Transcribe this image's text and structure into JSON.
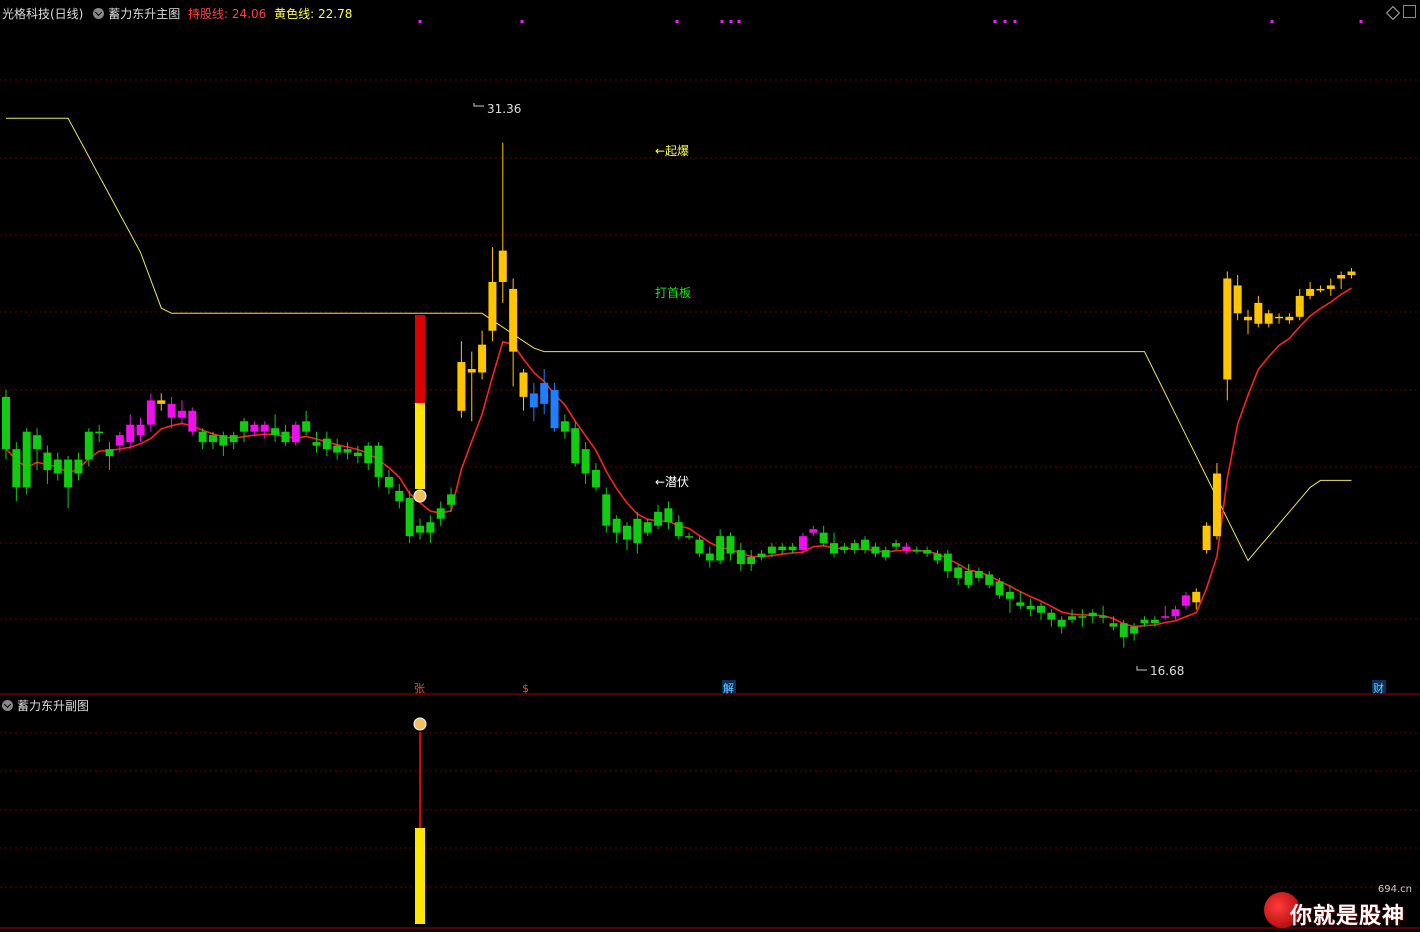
{
  "header": {
    "stock_name": "光格科技(日线)",
    "main_title": "蓄力东升主图",
    "hold_label": "持股线:",
    "hold_value": "24.06",
    "yellow_label": "黄色线:",
    "yellow_value": "22.78",
    "sub_title": "蓄力东升副图"
  },
  "colors": {
    "up_green": "#11cc11",
    "magenta": "#ee11ee",
    "orange": "#ffc600",
    "blue": "#1e7fff",
    "red_ma": "#ff2020",
    "yellow_line": "#e6e65a",
    "grid": "#6a0000",
    "hold_text": "#ff4040",
    "yellow_text": "#ffff40"
  },
  "annotations": {
    "high_label": "31.36",
    "low_label": "16.68",
    "qibao": "←起爆",
    "dashouban": "打首板",
    "qianfu": "←潜伏"
  },
  "markers": {
    "zhang": "张",
    "dollar": "$",
    "jie": "解",
    "cai": "财"
  },
  "watermark": {
    "text": "你就是股神",
    "site": "694.cn"
  },
  "chart_data": {
    "type": "candlestick",
    "ylim": [
      16.2,
      33.0
    ],
    "candles": [
      [
        23.9,
        22.4,
        24.1,
        22.1,
        "g"
      ],
      [
        22.4,
        21.3,
        22.6,
        20.9,
        "g"
      ],
      [
        22.9,
        21.3,
        23.0,
        21.1,
        "g"
      ],
      [
        22.8,
        22.4,
        23.0,
        21.8,
        "g"
      ],
      [
        22.3,
        21.8,
        22.5,
        21.4,
        "g"
      ],
      [
        22.1,
        21.7,
        22.3,
        21.5,
        "g"
      ],
      [
        22.1,
        21.3,
        22.2,
        20.7,
        "g"
      ],
      [
        21.7,
        22.1,
        22.3,
        21.5,
        "g"
      ],
      [
        22.1,
        22.9,
        23.0,
        21.9,
        "g"
      ],
      [
        22.9,
        22.9,
        23.1,
        22.6,
        "g"
      ],
      [
        22.2,
        22.4,
        22.6,
        21.8,
        "g"
      ],
      [
        22.8,
        22.5,
        22.9,
        22.3,
        "m"
      ],
      [
        23.1,
        22.6,
        23.4,
        22.4,
        "m"
      ],
      [
        23.1,
        22.8,
        23.3,
        22.6,
        "m"
      ],
      [
        23.8,
        23.1,
        24.0,
        22.9,
        "m"
      ],
      [
        23.8,
        23.7,
        24.0,
        23.5,
        "o"
      ],
      [
        23.7,
        23.3,
        23.9,
        23.0,
        "m"
      ],
      [
        23.5,
        23.3,
        23.8,
        23.1,
        "m"
      ],
      [
        23.5,
        22.9,
        23.6,
        22.8,
        "m"
      ],
      [
        22.9,
        22.6,
        23.0,
        22.4,
        "g"
      ],
      [
        22.8,
        22.6,
        22.9,
        22.4,
        "g"
      ],
      [
        22.8,
        22.5,
        22.9,
        22.2,
        "g"
      ],
      [
        22.8,
        22.6,
        22.9,
        22.4,
        "g"
      ],
      [
        23.2,
        22.9,
        23.3,
        22.6,
        "g"
      ],
      [
        23.1,
        22.9,
        23.2,
        22.8,
        "m"
      ],
      [
        23.1,
        22.9,
        23.2,
        22.7,
        "m"
      ],
      [
        23.0,
        22.8,
        23.4,
        22.6,
        "g"
      ],
      [
        22.9,
        22.6,
        23.1,
        22.5,
        "g"
      ],
      [
        23.1,
        22.6,
        23.2,
        22.5,
        "m"
      ],
      [
        23.2,
        22.9,
        23.5,
        22.8,
        "g"
      ],
      [
        22.6,
        22.5,
        22.9,
        22.3,
        "g"
      ],
      [
        22.7,
        22.4,
        22.9,
        22.2,
        "g"
      ],
      [
        22.5,
        22.3,
        22.7,
        22.1,
        "g"
      ],
      [
        22.4,
        22.3,
        22.6,
        22.1,
        "g"
      ],
      [
        22.3,
        22.2,
        22.5,
        22.0,
        "g"
      ],
      [
        22.5,
        22.0,
        22.6,
        21.8,
        "g"
      ],
      [
        22.5,
        21.6,
        22.6,
        21.3,
        "g"
      ],
      [
        21.6,
        21.3,
        21.8,
        21.1,
        "g"
      ],
      [
        21.2,
        20.9,
        21.4,
        20.7,
        "g"
      ],
      [
        21.0,
        19.9,
        21.2,
        19.7,
        "g"
      ],
      [
        20.0,
        20.2,
        20.4,
        19.8,
        "g"
      ],
      [
        20.3,
        20.0,
        20.5,
        19.7,
        "g"
      ],
      [
        20.7,
        20.4,
        20.9,
        20.2,
        "g"
      ],
      [
        21.1,
        20.8,
        21.3,
        20.6,
        "g"
      ],
      [
        23.5,
        24.9,
        25.5,
        23.3,
        "o"
      ],
      [
        24.6,
        24.7,
        25.2,
        23.2,
        "o"
      ],
      [
        24.6,
        25.4,
        25.8,
        24.4,
        "o"
      ],
      [
        25.8,
        27.2,
        28.2,
        25.5,
        "o"
      ],
      [
        27.2,
        28.1,
        31.2,
        26.6,
        "o"
      ],
      [
        27.0,
        25.2,
        27.3,
        24.2,
        "o"
      ],
      [
        24.6,
        23.9,
        24.7,
        23.5,
        "o"
      ],
      [
        24.0,
        23.6,
        24.3,
        23.2,
        "b"
      ],
      [
        24.3,
        23.7,
        24.7,
        23.4,
        "b"
      ],
      [
        24.1,
        23.0,
        24.3,
        22.9,
        "b"
      ],
      [
        23.2,
        22.9,
        23.4,
        22.7,
        "g"
      ],
      [
        23.0,
        22.0,
        23.2,
        21.9,
        "g"
      ],
      [
        22.4,
        21.7,
        22.6,
        21.4,
        "g"
      ],
      [
        21.8,
        21.3,
        22.0,
        21.2,
        "g"
      ],
      [
        21.1,
        20.2,
        21.3,
        20.0,
        "g"
      ],
      [
        20.4,
        20.0,
        20.5,
        19.7,
        "g"
      ],
      [
        20.2,
        19.8,
        20.3,
        19.5,
        "g"
      ],
      [
        20.4,
        19.7,
        20.6,
        19.4,
        "g"
      ],
      [
        20.3,
        20.0,
        20.4,
        19.9,
        "g"
      ],
      [
        20.6,
        20.2,
        20.8,
        20.1,
        "g"
      ],
      [
        20.7,
        20.3,
        20.9,
        20.1,
        "g"
      ],
      [
        20.3,
        19.9,
        20.5,
        19.8,
        "g"
      ],
      [
        19.9,
        19.9,
        20.0,
        19.8,
        "g"
      ],
      [
        19.8,
        19.4,
        19.9,
        19.3,
        "g"
      ],
      [
        19.4,
        19.2,
        19.6,
        19.0,
        "g"
      ],
      [
        19.9,
        19.2,
        20.1,
        19.1,
        "g"
      ],
      [
        19.9,
        19.4,
        20.0,
        19.2,
        "g"
      ],
      [
        19.5,
        19.1,
        19.7,
        18.9,
        "g"
      ],
      [
        19.3,
        19.1,
        19.5,
        18.9,
        "g"
      ],
      [
        19.4,
        19.3,
        19.5,
        19.2,
        "g"
      ],
      [
        19.6,
        19.4,
        19.7,
        19.3,
        "g"
      ],
      [
        19.6,
        19.5,
        19.7,
        19.4,
        "g"
      ],
      [
        19.6,
        19.5,
        19.7,
        19.4,
        "g"
      ],
      [
        19.9,
        19.5,
        20.0,
        19.4,
        "m"
      ],
      [
        20.1,
        20.0,
        20.2,
        19.9,
        "m"
      ],
      [
        20.0,
        19.7,
        20.2,
        19.6,
        "g"
      ],
      [
        19.7,
        19.4,
        20.0,
        19.3,
        "g"
      ],
      [
        19.6,
        19.5,
        19.7,
        19.4,
        "g"
      ],
      [
        19.7,
        19.5,
        19.8,
        19.4,
        "g"
      ],
      [
        19.8,
        19.5,
        19.9,
        19.4,
        "g"
      ],
      [
        19.6,
        19.4,
        19.7,
        19.3,
        "g"
      ],
      [
        19.5,
        19.3,
        19.6,
        19.2,
        "g"
      ],
      [
        19.7,
        19.6,
        19.8,
        19.5,
        "g"
      ],
      [
        19.6,
        19.5,
        19.7,
        19.4,
        "m"
      ],
      [
        19.5,
        19.5,
        19.6,
        19.4,
        "g"
      ],
      [
        19.5,
        19.4,
        19.6,
        19.3,
        "g"
      ],
      [
        19.4,
        19.2,
        19.5,
        19.1,
        "g"
      ],
      [
        19.4,
        18.9,
        19.5,
        18.7,
        "g"
      ],
      [
        19.0,
        18.7,
        19.1,
        18.5,
        "g"
      ],
      [
        18.9,
        18.5,
        19.1,
        18.4,
        "g"
      ],
      [
        18.9,
        18.7,
        19.0,
        18.6,
        "g"
      ],
      [
        18.8,
        18.5,
        18.9,
        18.4,
        "g"
      ],
      [
        18.6,
        18.2,
        18.7,
        18.1,
        "g"
      ],
      [
        18.3,
        18.1,
        18.5,
        17.7,
        "g"
      ],
      [
        18.0,
        17.9,
        18.3,
        17.8,
        "g"
      ],
      [
        17.9,
        17.8,
        18.1,
        17.6,
        "g"
      ],
      [
        17.9,
        17.7,
        18.0,
        17.5,
        "g"
      ],
      [
        17.7,
        17.5,
        17.8,
        17.3,
        "g"
      ],
      [
        17.5,
        17.3,
        17.6,
        17.1,
        "g"
      ],
      [
        17.6,
        17.5,
        17.8,
        17.4,
        "g"
      ],
      [
        17.6,
        17.6,
        17.8,
        17.3,
        "g"
      ],
      [
        17.7,
        17.6,
        17.8,
        17.4,
        "g"
      ],
      [
        17.6,
        17.6,
        17.9,
        17.4,
        "g"
      ],
      [
        17.4,
        17.3,
        17.6,
        17.2,
        "g"
      ],
      [
        17.4,
        17.0,
        17.5,
        16.7,
        "g"
      ],
      [
        17.3,
        17.1,
        17.4,
        16.9,
        "g"
      ],
      [
        17.5,
        17.4,
        17.6,
        17.3,
        "g"
      ],
      [
        17.5,
        17.4,
        17.6,
        17.3,
        "g"
      ],
      [
        17.6,
        17.6,
        17.9,
        17.5,
        "m"
      ],
      [
        17.8,
        17.6,
        17.9,
        17.5,
        "m"
      ],
      [
        18.2,
        17.9,
        18.3,
        17.8,
        "m"
      ],
      [
        18.3,
        18.0,
        18.4,
        17.8,
        "o"
      ],
      [
        19.5,
        20.2,
        20.3,
        19.4,
        "o"
      ],
      [
        19.9,
        21.7,
        22.0,
        19.8,
        "o"
      ],
      [
        24.4,
        27.3,
        27.5,
        23.8,
        "o"
      ],
      [
        26.3,
        27.1,
        27.4,
        26.1,
        "o"
      ],
      [
        26.2,
        26.1,
        26.4,
        25.7,
        "o"
      ],
      [
        26.0,
        26.6,
        26.8,
        25.9,
        "o"
      ],
      [
        26.3,
        26.0,
        26.4,
        25.9,
        "o"
      ],
      [
        26.2,
        26.2,
        26.3,
        26.0,
        "o"
      ],
      [
        26.2,
        26.1,
        26.3,
        26.0,
        "o"
      ],
      [
        26.2,
        26.8,
        27.0,
        26.1,
        "o"
      ],
      [
        26.8,
        27.0,
        27.2,
        26.7,
        "o"
      ],
      [
        27.0,
        27.0,
        27.1,
        26.9,
        "o"
      ],
      [
        27.0,
        27.1,
        27.3,
        26.8,
        "o"
      ],
      [
        27.3,
        27.4,
        27.5,
        27.0,
        "o"
      ],
      [
        27.4,
        27.5,
        27.6,
        27.3,
        "o"
      ]
    ]
  }
}
